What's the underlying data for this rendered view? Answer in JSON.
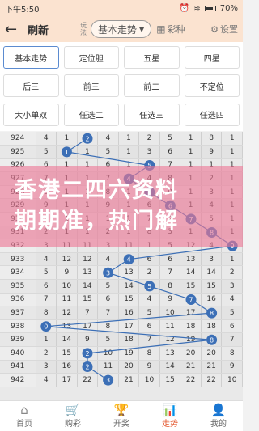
{
  "status_bar": {
    "time": "下午5:50",
    "battery": "70%"
  },
  "header": {
    "back_icon": "arrow-left-icon",
    "refresh": "刷新",
    "play_label": "玩法",
    "play_value": "基本走势",
    "color_type": "彩种",
    "settings": "设置"
  },
  "options": [
    "基本走势",
    "定位胆",
    "五星",
    "四星",
    "后三",
    "前三",
    "前二",
    "不定位",
    "大小单双",
    "任选二",
    "任选三",
    "任选四"
  ],
  "selected_option": 0,
  "table": {
    "rows": [
      {
        "issue": "924",
        "cells": [
          "4",
          "1",
          "2",
          "4",
          "1",
          "2",
          "5",
          "1",
          "8",
          "1",
          "5"
        ],
        "hit": 2
      },
      {
        "issue": "925",
        "cells": [
          "5",
          "1",
          "1",
          "5",
          "1",
          "3",
          "6",
          "1",
          "9",
          "1",
          "6"
        ],
        "hit": 1
      },
      {
        "issue": "926",
        "cells": [
          "6",
          "1",
          "1",
          "6",
          "1",
          "5",
          "7",
          "1",
          "1",
          "1",
          "7"
        ],
        "hit": 5
      },
      {
        "issue": "927",
        "cells": [
          "7",
          "1",
          "1",
          "7",
          "1",
          "4",
          "8",
          "1",
          "2",
          "1",
          "8"
        ],
        "hit": 4
      },
      {
        "issue": "928",
        "cells": [
          "8",
          "1",
          "1",
          "8",
          "1",
          "5",
          "9",
          "1",
          "3",
          "1",
          "9"
        ],
        "hit": 5
      },
      {
        "issue": "929",
        "cells": [
          "9",
          "1",
          "1",
          "9",
          "1",
          "6",
          "1",
          "1",
          "4",
          "1",
          "1"
        ],
        "hit": 6
      },
      {
        "issue": "930",
        "cells": [
          "1",
          "1",
          "1",
          "1",
          "1",
          "7",
          "2",
          "1",
          "5",
          "1",
          "2"
        ],
        "hit": 7
      },
      {
        "issue": "931",
        "cells": [
          "2",
          "1",
          "1",
          "2",
          "1",
          "8",
          "3",
          "1",
          "6",
          "1",
          "3"
        ],
        "hit": 8
      },
      {
        "issue": "932",
        "cells": [
          "3",
          "11",
          "11",
          "3",
          "11",
          "1",
          "5",
          "12",
          "4",
          "9",
          "1"
        ],
        "hit": 9
      },
      {
        "issue": "933",
        "cells": [
          "4",
          "12",
          "12",
          "4",
          "1",
          "6",
          "6",
          "13",
          "3",
          "1",
          "2"
        ],
        "hit": 4
      },
      {
        "issue": "934",
        "cells": [
          "5",
          "9",
          "13",
          "3",
          "13",
          "2",
          "7",
          "14",
          "14",
          "2",
          "3"
        ],
        "hit": 3
      },
      {
        "issue": "935",
        "cells": [
          "6",
          "10",
          "14",
          "5",
          "14",
          "5",
          "8",
          "15",
          "15",
          "3",
          "4"
        ],
        "hit": 5
      },
      {
        "issue": "936",
        "cells": [
          "7",
          "11",
          "15",
          "6",
          "15",
          "4",
          "9",
          "7",
          "16",
          "4",
          "5"
        ],
        "hit": 7
      },
      {
        "issue": "937",
        "cells": [
          "8",
          "12",
          "7",
          "7",
          "16",
          "5",
          "10",
          "17",
          "8",
          "5",
          "6"
        ],
        "hit": 8
      },
      {
        "issue": "938",
        "cells": [
          "0",
          "13",
          "17",
          "8",
          "17",
          "6",
          "11",
          "18",
          "18",
          "6",
          "7"
        ],
        "hit": 0
      },
      {
        "issue": "939",
        "cells": [
          "1",
          "14",
          "9",
          "5",
          "18",
          "7",
          "12",
          "19",
          "8",
          "7",
          "8"
        ],
        "hit": 8
      },
      {
        "issue": "940",
        "cells": [
          "2",
          "15",
          "2",
          "10",
          "19",
          "8",
          "13",
          "20",
          "20",
          "8",
          "9"
        ],
        "hit": 2
      },
      {
        "issue": "941",
        "cells": [
          "3",
          "16",
          "21",
          "11",
          "20",
          "9",
          "14",
          "21",
          "21",
          "9",
          "10"
        ],
        "hit": 2
      },
      {
        "issue": "942",
        "cells": [
          "4",
          "17",
          "22",
          "12",
          "21",
          "10",
          "15",
          "22",
          "22",
          "10",
          "11"
        ],
        "hit": 3
      }
    ]
  },
  "overlay": {
    "line1": "香港二四六资料",
    "line2": "期期准，热门解"
  },
  "tabbar": [
    {
      "label": "首页",
      "icon": "home-icon"
    },
    {
      "label": "购彩",
      "icon": "cart-icon"
    },
    {
      "label": "开奖",
      "icon": "trophy-icon"
    },
    {
      "label": "走势",
      "icon": "chart-icon"
    },
    {
      "label": "我的",
      "icon": "user-icon"
    }
  ],
  "active_tab": 3,
  "colors": {
    "accent": "#e4572e",
    "ball": "#3c6fb6",
    "header_bg": "#fbe3d0"
  }
}
